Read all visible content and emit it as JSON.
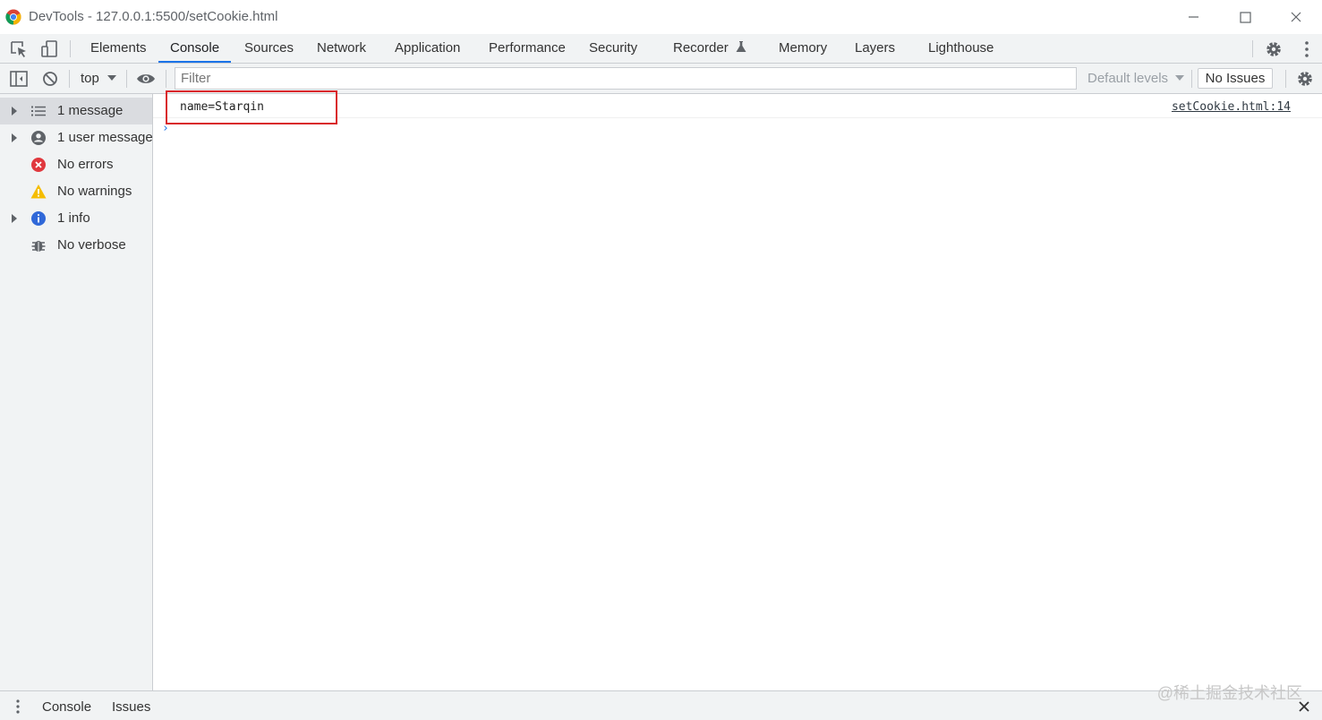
{
  "window": {
    "title": "DevTools - 127.0.0.1:5500/setCookie.html"
  },
  "tabs": [
    {
      "label": "Elements",
      "active": false
    },
    {
      "label": "Console",
      "active": true
    },
    {
      "label": "Sources",
      "active": false
    },
    {
      "label": "Network",
      "active": false
    },
    {
      "label": "Application",
      "active": false
    },
    {
      "label": "Performance",
      "active": false
    },
    {
      "label": "Security",
      "active": false
    },
    {
      "label": "Recorder",
      "active": false
    },
    {
      "label": "Memory",
      "active": false
    },
    {
      "label": "Layers",
      "active": false
    },
    {
      "label": "Lighthouse",
      "active": false
    }
  ],
  "toolbar": {
    "context": "top",
    "filter_placeholder": "Filter",
    "levels": "Default levels",
    "issues": "No Issues"
  },
  "sidebar": {
    "items": [
      {
        "label": "1 message",
        "icon": "list-icon",
        "expandable": true,
        "selected": true
      },
      {
        "label": "1 user message",
        "icon": "user-circle-icon",
        "expandable": true,
        "selected": false
      },
      {
        "label": "No errors",
        "icon": "error-icon",
        "expandable": false,
        "selected": false
      },
      {
        "label": "No warnings",
        "icon": "warning-icon",
        "expandable": false,
        "selected": false
      },
      {
        "label": "1 info",
        "icon": "info-icon",
        "expandable": true,
        "selected": false
      },
      {
        "label": "No verbose",
        "icon": "bug-icon",
        "expandable": false,
        "selected": false
      }
    ]
  },
  "console": {
    "messages": [
      {
        "text": "name=Starqin",
        "source": "setCookie.html:14"
      }
    ],
    "prompt": "›"
  },
  "drawer": {
    "tabs": [
      "Console",
      "Issues"
    ]
  },
  "watermark": "@稀土掘金技术社区",
  "colors": {
    "accent": "#1a73e8",
    "highlight_box": "#d9252b",
    "error": "#e0383e",
    "warning": "#f5bd00",
    "info": "#3068d8"
  }
}
